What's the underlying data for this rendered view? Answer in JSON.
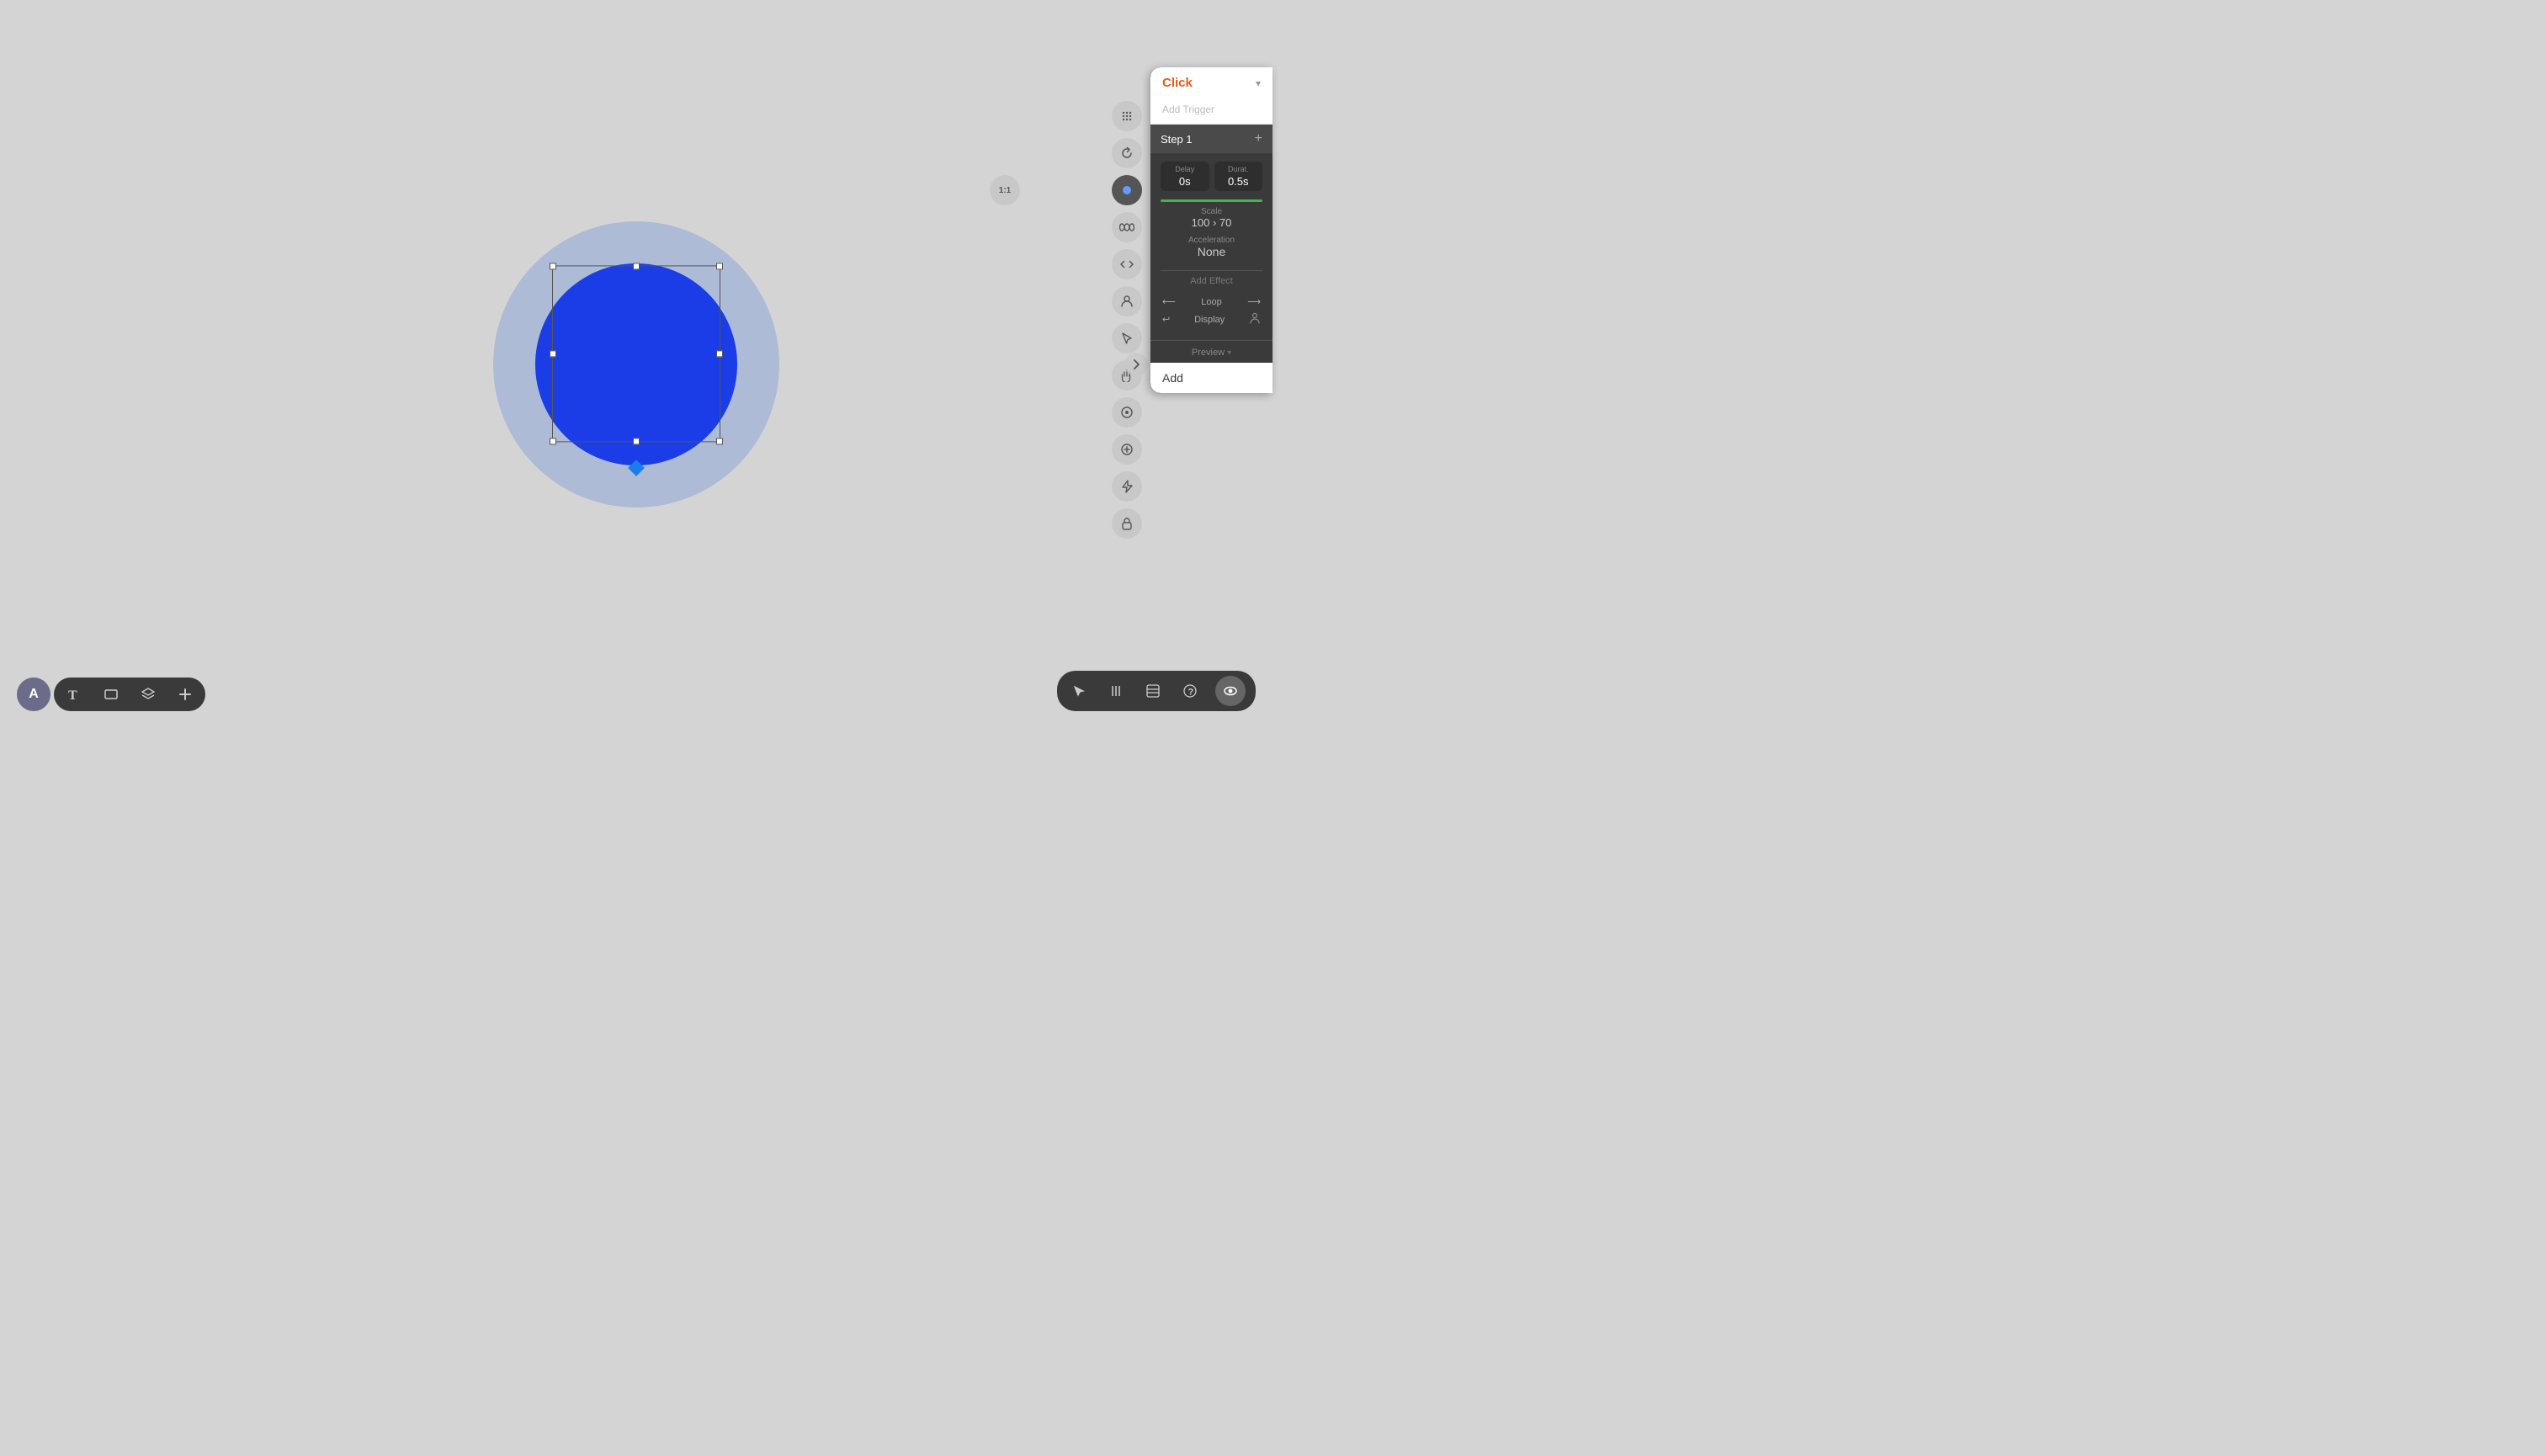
{
  "canvas": {
    "background": "#d4d4d4"
  },
  "anim_panel": {
    "trigger_label": "Click",
    "trigger_chevron": "▾",
    "add_trigger": "Add Trigger",
    "step_label": "Step 1",
    "step_plus": "+",
    "delay_title": "Delay",
    "delay_value": "0s",
    "durat_title": "Durat.",
    "durat_value": "0.5s",
    "scale_title": "Scale",
    "scale_value": "100 › 70",
    "accel_title": "Acceleration",
    "accel_value": "None",
    "add_effect": "Add Effect",
    "loop_label": "Loop",
    "display_label": "Display",
    "preview_label": "Preview",
    "add_label": "Add"
  },
  "bottom_toolbar": {
    "avatar_letter": "A",
    "text_tool": "T",
    "frame_tool": "▭",
    "layers_tool": "⊞",
    "add_tool": "+"
  },
  "bottom_right_toolbar": {
    "select_tool": "⬡",
    "columns_tool": "|||",
    "layout_tool": "⊟",
    "help_tool": "?",
    "preview_tool": "👁"
  },
  "sidebar_icons": {
    "grid_icon": "⊞",
    "ratio_icon": "1:1",
    "refresh_icon": "↺",
    "color_icon": "●",
    "infinite_icon": "∞",
    "code_icon": "</>",
    "user_icon": "👤",
    "cursor_icon": "↖",
    "hand_icon": "✋",
    "sphere_icon": "◉",
    "plus_circle_icon": "⊕",
    "lightning_icon": "⚡",
    "lock_icon": "🔒"
  },
  "colors": {
    "accent_orange": "#e85a1a",
    "inner_circle": "#1a3de8",
    "outer_circle": "rgba(100,140,220,0.35)",
    "panel_bg": "#3a3a3a",
    "panel_header_bg": "#ffffff",
    "step_header_bg": "#4a4a4a",
    "green_bar": "#4caf50"
  }
}
